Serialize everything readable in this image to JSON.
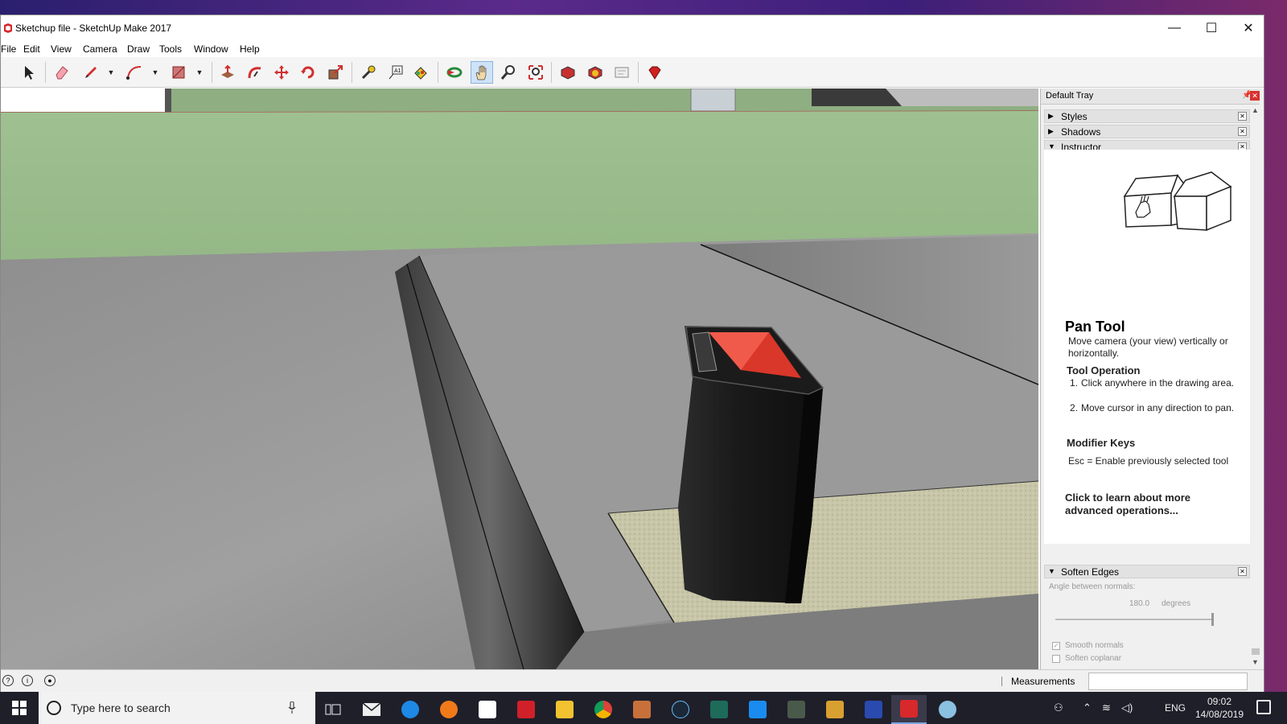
{
  "window": {
    "title": "Sketchup file - SketchUp Make 2017",
    "controls": {
      "minimize": "—",
      "maximize": "☐",
      "close": "✕"
    }
  },
  "menu": [
    "File",
    "Edit",
    "View",
    "Camera",
    "Draw",
    "Tools",
    "Window",
    "Help"
  ],
  "toolbar": {
    "tools": [
      "select",
      "eraser",
      "line",
      "arc",
      "rectangle",
      "push-pull",
      "follow-me",
      "move",
      "rotate",
      "scale",
      "tape-measure",
      "text",
      "paint-bucket",
      "orbit",
      "pan",
      "zoom",
      "zoom-extents",
      "3d-warehouse",
      "extension-warehouse",
      "layout",
      "ruby-console"
    ],
    "active_tool": "pan"
  },
  "tray": {
    "title": "Default Tray",
    "panels": [
      {
        "label": "Styles",
        "state": "collapsed"
      },
      {
        "label": "Shadows",
        "state": "collapsed"
      },
      {
        "label": "Instructor",
        "state": "expanded"
      }
    ],
    "instructor": {
      "tool_name": "Pan Tool",
      "description": "Move camera (your view) vertically or horizontally.",
      "operation_title": "Tool Operation",
      "operation_steps": [
        {
          "num": "1.",
          "text": "Click anywhere in the drawing area."
        },
        {
          "num": "2.",
          "text": "Move cursor in any direction to pan."
        }
      ],
      "modifier_title": "Modifier Keys",
      "modifier_text": "Esc = Enable previously selected tool",
      "learn_more": "Click to learn about more advanced operations..."
    },
    "soften_edges": {
      "label": "Soften Edges",
      "angle_label": "Angle between normals:",
      "angle_value": "180.0",
      "angle_unit": "degrees",
      "slider_fraction": 1.0,
      "smooth_normals_label": "Smooth normals",
      "smooth_normals_checked": true,
      "soften_coplanar_label": "Soften coplanar",
      "soften_coplanar_checked": false
    }
  },
  "statusbar": {
    "measurements_label": "Measurements",
    "measurements_value": ""
  },
  "taskbar": {
    "search_placeholder": "Type here to search",
    "apps": [
      "task-view",
      "mail",
      "edge",
      "avast",
      "store",
      "mcafee",
      "file-explorer",
      "chrome",
      "app-creation",
      "steam",
      "app-green",
      "app-blue",
      "game-photo",
      "game-sign",
      "app-f",
      "sketchup",
      "paint"
    ],
    "active_app": "sketchup",
    "language": "ENG",
    "time": "09:02",
    "date": "14/08/2019"
  },
  "colors": {
    "wall": "#9cbd8e",
    "floor": "#8d8d8d",
    "tool_active_bg": "#cfe3f7",
    "bin_red": "#d8372a"
  }
}
